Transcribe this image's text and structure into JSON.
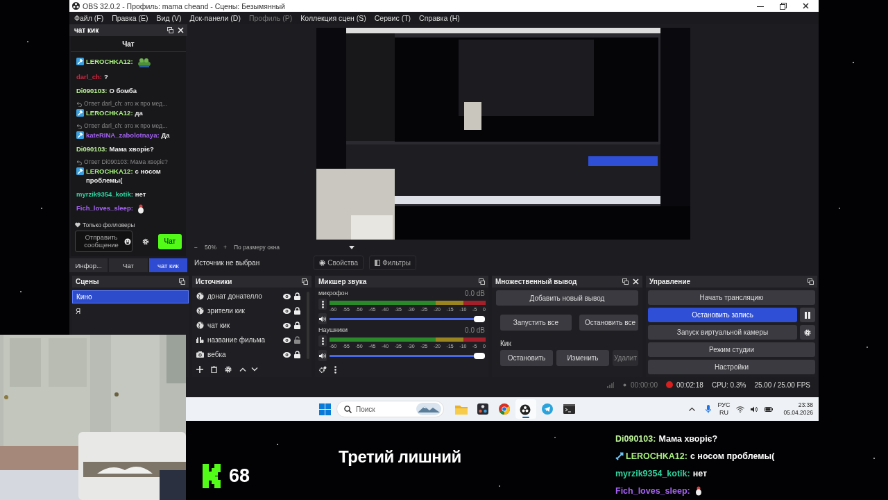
{
  "window": {
    "title": "OBS 32.0.2 - Профиль: mama cheand - Сцены: Безымянный"
  },
  "menu": [
    {
      "label": "Файл (F)",
      "disabled": false
    },
    {
      "label": "Правка (E)",
      "disabled": false
    },
    {
      "label": "Вид (V)",
      "disabled": false
    },
    {
      "label": "Док-панели (D)",
      "disabled": false
    },
    {
      "label": "Профиль (P)",
      "disabled": true
    },
    {
      "label": "Коллекция сцен (S)",
      "disabled": false
    },
    {
      "label": "Сервис (T)",
      "disabled": false
    },
    {
      "label": "Справка (H)",
      "disabled": false
    }
  ],
  "chat_dock": {
    "title": "чат кик",
    "heading": "Чат",
    "messages": [
      {
        "kind": "message",
        "badge": true,
        "user": "LEROCHKA12:",
        "color": "#a8f07e",
        "emote": {
          "kind": "frog"
        }
      },
      {
        "kind": "message",
        "badge": false,
        "user": "darl_ch:",
        "color": "#d0263f",
        "text": "?"
      },
      {
        "kind": "message",
        "badge": false,
        "user": "Di090103:",
        "color": "#bff59a",
        "text": "О бомба"
      },
      {
        "kind": "reply",
        "text": "Ответ darl_ch: это ж про мед..."
      },
      {
        "kind": "message",
        "badge": true,
        "user": "LEROCHKA12:",
        "color": "#a8f07e",
        "text": "да"
      },
      {
        "kind": "reply",
        "text": "Ответ darl_ch: это ж про мед..."
      },
      {
        "kind": "message",
        "badge": true,
        "user": "kateRINA_zabolotnaya:",
        "color": "#a463f2",
        "text": "Да"
      },
      {
        "kind": "message",
        "badge": false,
        "user": "Di090103:",
        "color": "#bff59a",
        "text": "Мама хворіє?"
      },
      {
        "kind": "reply",
        "text": "Ответ Di090103: Мама хворіє?"
      },
      {
        "kind": "message",
        "badge": true,
        "user": "LEROCHKA12:",
        "color": "#a8f07e",
        "text": "с носом проблемы("
      },
      {
        "kind": "message",
        "badge": false,
        "user": "myrzik9354_kotik:",
        "color": "#2fd6a0",
        "text": "нет"
      },
      {
        "kind": "message",
        "badge": false,
        "user": "Fich_loves_sleep:",
        "color": "#a663f5",
        "emote": {
          "kind": "figure"
        }
      }
    ],
    "mode": "Только фолловеры",
    "input": {
      "placeholder": "Отправить сообщение"
    },
    "send_button": "Чат"
  },
  "dock_tabs": [
    {
      "label": "Инфор...",
      "selected": false
    },
    {
      "label": "Чат",
      "selected": false
    },
    {
      "label": "чат кик",
      "selected": true
    }
  ],
  "preview_bar": {
    "zoom_out": "−",
    "zoom": "50%",
    "zoom_in": "+",
    "fit": "По размеру окна"
  },
  "source_bar": {
    "status": "Источник не выбран",
    "properties_button": "Свойства",
    "filters_button": "Фильтры"
  },
  "scenes": {
    "title": "Сцены",
    "items": [
      {
        "label": "Кино",
        "selected": true
      },
      {
        "label": "Я",
        "selected": false
      }
    ]
  },
  "sources": {
    "title": "Источники",
    "items": [
      {
        "label": "донат донателло",
        "kind": "browser",
        "visible": true,
        "locked": true
      },
      {
        "label": "зрители кик",
        "kind": "browser",
        "visible": true,
        "locked": true
      },
      {
        "label": "чат кик",
        "kind": "browser",
        "visible": true,
        "locked": true
      },
      {
        "label": "название фильма",
        "kind": "text",
        "visible": true,
        "locked": false
      },
      {
        "label": "вебка",
        "kind": "camera",
        "visible": true,
        "locked": true
      }
    ]
  },
  "mixer": {
    "title": "Микшер звука",
    "channels": [
      {
        "name": "микрофон",
        "reading": "0.0 dB",
        "level": 1,
        "scale": [
          "-60",
          "-55",
          "-50",
          "-45",
          "-40",
          "-35",
          "-30",
          "-25",
          "-20",
          "-15",
          "-10",
          "-5",
          "0"
        ]
      },
      {
        "name": "Наушники",
        "reading": "0.0 dB",
        "level": 1,
        "scale": [
          "-60",
          "-55",
          "-50",
          "-45",
          "-40",
          "-35",
          "-30",
          "-25",
          "-20",
          "-15",
          "-10",
          "-5",
          "0"
        ]
      }
    ]
  },
  "multi_output": {
    "title": "Множественный вывод",
    "add_button": "Добавить новый вывод",
    "start_all": "Запустить все",
    "stop_all": "Остановить все",
    "outputs": [
      {
        "name": "Кик",
        "buttons": [
          "Остановить",
          "Изменить",
          "Удалит"
        ]
      }
    ]
  },
  "controls": {
    "title": "Управление",
    "buttons": [
      {
        "label": "Начать трансляцию",
        "active": false
      },
      {
        "label": "Остановить запись",
        "active": true,
        "side": {
          "kind": "pause"
        }
      },
      {
        "label": "Запуск виртуальной камеры",
        "active": false,
        "side": {
          "kind": "settings"
        }
      },
      {
        "label": "Режим студии",
        "active": false
      },
      {
        "label": "Настройки",
        "active": false
      }
    ]
  },
  "status_bar": {
    "stream_time": "00:00:00",
    "recording": true,
    "record_time": "00:02:18",
    "cpu": "CPU: 0.3%",
    "fps": "25.00 / 25.00 FPS"
  },
  "taskbar": {
    "search_placeholder": "Поиск",
    "apps": [
      {
        "kind": "folder",
        "active": false
      },
      {
        "kind": "palette",
        "active": false
      },
      {
        "kind": "browser",
        "active": false
      },
      {
        "kind": "disc",
        "active": true
      },
      {
        "kind": "plane",
        "active": false
      },
      {
        "kind": "terminal",
        "active": false
      }
    ],
    "language": "РУС",
    "region": "RU",
    "time": "23:38",
    "date": "05.04.2026"
  },
  "overlay": {
    "viewers": "68",
    "movie_title": "Третий лишний",
    "chat": [
      {
        "badge": false,
        "user": "Di090103:",
        "color": "#bff59a",
        "text": "Мама хворіє?"
      },
      {
        "badge": true,
        "user": "LEROCHKA12:",
        "color": "#a8f07e",
        "text": "с носом проблемы("
      },
      {
        "badge": false,
        "user": "myrzik9354_kotik:",
        "color": "#2fd6a0",
        "text": "нет"
      },
      {
        "badge": false,
        "user": "Fich_loves_sleep:",
        "color": "#a663f5",
        "emote": {
          "kind": "figure"
        }
      }
    ]
  }
}
